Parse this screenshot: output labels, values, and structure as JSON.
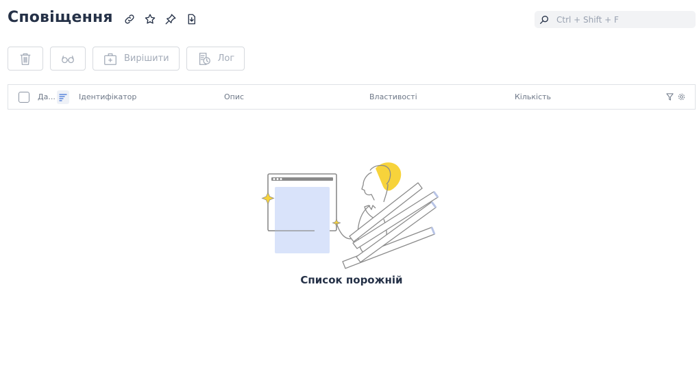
{
  "header": {
    "title": "Сповіщення",
    "icons": [
      "link-icon",
      "star-icon",
      "pin-icon",
      "export-icon"
    ]
  },
  "search": {
    "placeholder": "Ctrl + Shift + F",
    "value": ""
  },
  "toolbar": {
    "delete_icon": "trash-icon",
    "view_icon": "glasses-icon",
    "resolve_label": "Вирішити",
    "log_label": "Лог"
  },
  "grid": {
    "columns": [
      "Да...",
      "Ідентифікатор",
      "Опис",
      "Властивості",
      "Кількість"
    ]
  },
  "empty_state": {
    "text": "Список порожній"
  },
  "colors": {
    "title": "#253147",
    "muted": "#a3abb8",
    "accent_yellow": "#f7d33b",
    "placeholder_fill": "#d9e3fa"
  }
}
